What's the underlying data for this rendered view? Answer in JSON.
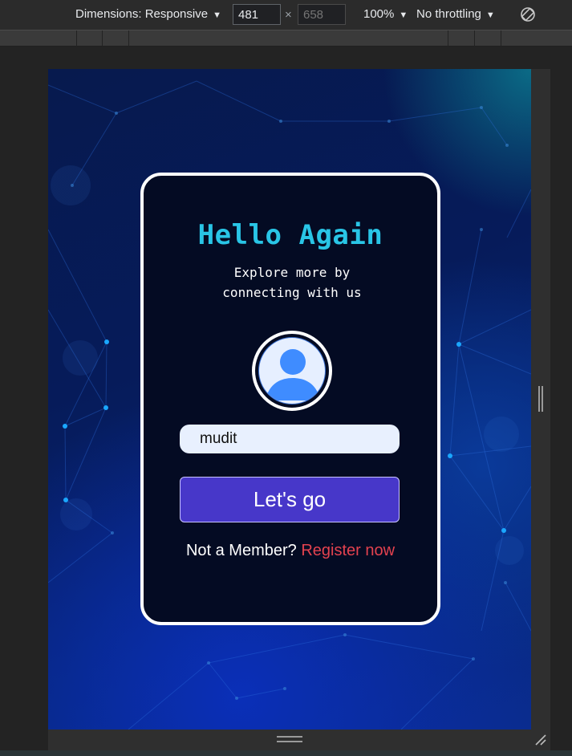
{
  "devtools": {
    "dimensions_label": "Dimensions: Responsive",
    "width_value": "481",
    "height_placeholder": "658",
    "times": "×",
    "zoom_label": "100%",
    "throttling_label": "No throttling",
    "caret": "▼"
  },
  "card": {
    "title": "Hello Again",
    "subtitle": "Explore more by connecting with us",
    "name_value": "mudit",
    "button_label": "Let's go",
    "footer_text": "Not a Member?",
    "register_label": "Register now"
  },
  "colors": {
    "title": "#29c5e6",
    "button_bg": "#4737c9",
    "register_link": "#e4424f",
    "card_bg": "#040b23"
  },
  "icons": {
    "avatar": "user-avatar-icon",
    "rotate": "rotate-device-icon",
    "resize": "resize-corner-icon"
  }
}
